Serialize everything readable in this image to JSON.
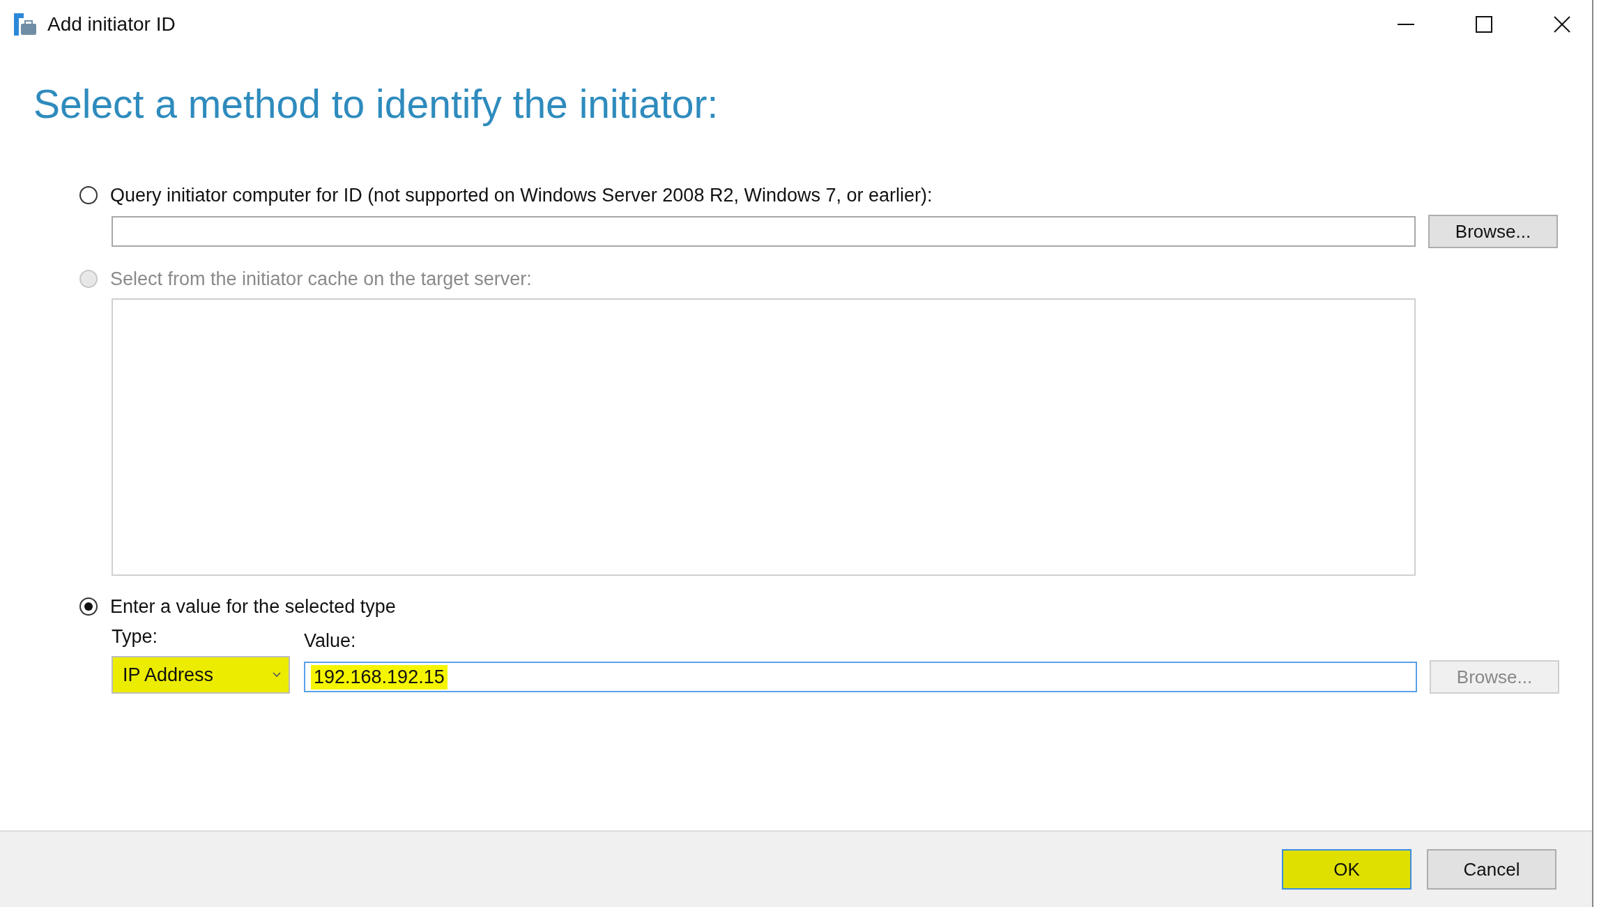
{
  "window": {
    "title": "Add initiator ID"
  },
  "heading": "Select a method to identify the initiator:",
  "options": [
    {
      "kind": "query",
      "label": "Query initiator computer for ID (not supported on Windows Server 2008 R2, Windows 7, or earlier):",
      "selected": false,
      "disabled": false,
      "browse": {
        "label": "Browse...",
        "disabled": false
      }
    },
    {
      "kind": "list",
      "label": "Select from the initiator cache on the target server:",
      "selected": false,
      "disabled": true
    },
    {
      "kind": "typed",
      "label": "Enter a value for the selected type",
      "selected": true,
      "disabled": false,
      "type_label": "Type:",
      "value_label": "Value:",
      "type_combo": {
        "value": "IP Address",
        "highlighted": true
      },
      "value_field": {
        "value": "192.168.192.15",
        "highlighted": true,
        "focused": true
      },
      "browse": {
        "label": "Browse...",
        "disabled": true
      }
    }
  ],
  "buttons": [
    {
      "label": "OK",
      "default": true,
      "highlighted": true
    },
    {
      "label": "Cancel",
      "default": false,
      "highlighted": false
    }
  ]
}
